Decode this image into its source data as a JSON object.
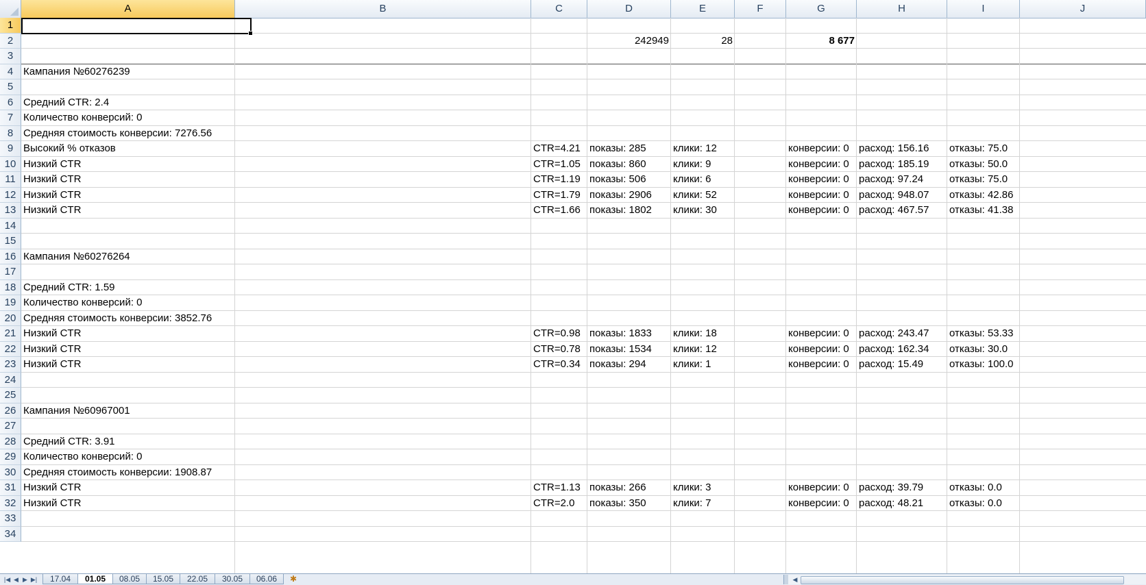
{
  "columns": [
    "A",
    "B",
    "C",
    "D",
    "E",
    "F",
    "G",
    "H",
    "I",
    "J"
  ],
  "rows": [
    "1",
    "2",
    "3",
    "4",
    "5",
    "6",
    "7",
    "8",
    "9",
    "10",
    "11",
    "12",
    "13",
    "14",
    "15",
    "16",
    "17",
    "18",
    "19",
    "20",
    "21",
    "22",
    "23",
    "24",
    "25",
    "26",
    "27",
    "28",
    "29",
    "30",
    "31",
    "32",
    "33",
    "34"
  ],
  "cells": {
    "D2": "242949",
    "E2": "28",
    "G2": "8 677",
    "A4": "Кампания №60276239",
    "A6": "Средний CTR: 2.4",
    "A7": "Количество конверсий: 0",
    "A8": "Средняя стоимость конверсии: 7276.56",
    "A9": "Высокий % отказов",
    "C9": "CTR=4.21",
    "D9": "показы: 285",
    "E9": "клики: 12",
    "G9": "конверсии: 0",
    "H9": "расход: 156.16",
    "I9": "отказы: 75.0",
    "A10": "Низкий CTR",
    "C10": "CTR=1.05",
    "D10": "показы: 860",
    "E10": "клики: 9",
    "G10": "конверсии: 0",
    "H10": "расход: 185.19",
    "I10": "отказы: 50.0",
    "A11": "Низкий CTR",
    "C11": "CTR=1.19",
    "D11": "показы: 506",
    "E11": "клики: 6",
    "G11": "конверсии: 0",
    "H11": "расход: 97.24",
    "I11": "отказы: 75.0",
    "A12": "Низкий CTR",
    "C12": "CTR=1.79",
    "D12": "показы: 2906",
    "E12": "клики: 52",
    "G12": "конверсии: 0",
    "H12": "расход: 948.07",
    "I12": "отказы: 42.86",
    "A13": "Низкий CTR",
    "C13": "CTR=1.66",
    "D13": "показы: 1802",
    "E13": "клики: 30",
    "G13": "конверсии: 0",
    "H13": "расход: 467.57",
    "I13": "отказы: 41.38",
    "A16": "Кампания №60276264",
    "A18": "Средний CTR: 1.59",
    "A19": "Количество конверсий: 0",
    "A20": "Средняя стоимость конверсии: 3852.76",
    "A21": "Низкий CTR",
    "C21": "CTR=0.98",
    "D21": "показы: 1833",
    "E21": "клики: 18",
    "G21": "конверсии: 0",
    "H21": "расход: 243.47",
    "I21": "отказы: 53.33",
    "A22": "Низкий CTR",
    "C22": "CTR=0.78",
    "D22": "показы: 1534",
    "E22": "клики: 12",
    "G22": "конверсии: 0",
    "H22": "расход: 162.34",
    "I22": "отказы: 30.0",
    "A23": "Низкий CTR",
    "C23": "CTR=0.34",
    "D23": "показы: 294",
    "E23": "клики: 1",
    "G23": "конверсии: 0",
    "H23": "расход: 15.49",
    "I23": "отказы: 100.0",
    "A26": "Кампания №60967001",
    "A28": "Средний CTR: 3.91",
    "A29": "Количество конверсий: 0",
    "A30": "Средняя стоимость конверсии: 1908.87",
    "A31": "Низкий CTR",
    "C31": "CTR=1.13",
    "D31": "показы: 266",
    "E31": "клики: 3",
    "G31": "конверсии: 0",
    "H31": "расход: 39.79",
    "I31": "отказы: 0.0",
    "A32": "Низкий CTR",
    "C32": "CTR=2.0",
    "D32": "показы: 350",
    "E32": "клики: 7",
    "G32": "конверсии: 0",
    "H32": "расход: 48.21",
    "I32": "отказы: 0.0"
  },
  "right_aligned": [
    "D2",
    "E2",
    "G2"
  ],
  "bold": [
    "G2"
  ],
  "selected_cell": "A1",
  "sheet_tabs": [
    "17.04",
    "01.05",
    "08.05",
    "15.05",
    "22.05",
    "30.05",
    "06.06"
  ],
  "active_tab": "01.05",
  "nav_icons": [
    "first-sheet-icon",
    "prev-sheet-icon",
    "next-sheet-icon",
    "last-sheet-icon"
  ],
  "new_sheet_icon": "insert-sheet-icon",
  "colors": {
    "header_border": "#9eb6ce",
    "selected_header": "#f7c95c",
    "gridline": "#d4d4d4"
  }
}
